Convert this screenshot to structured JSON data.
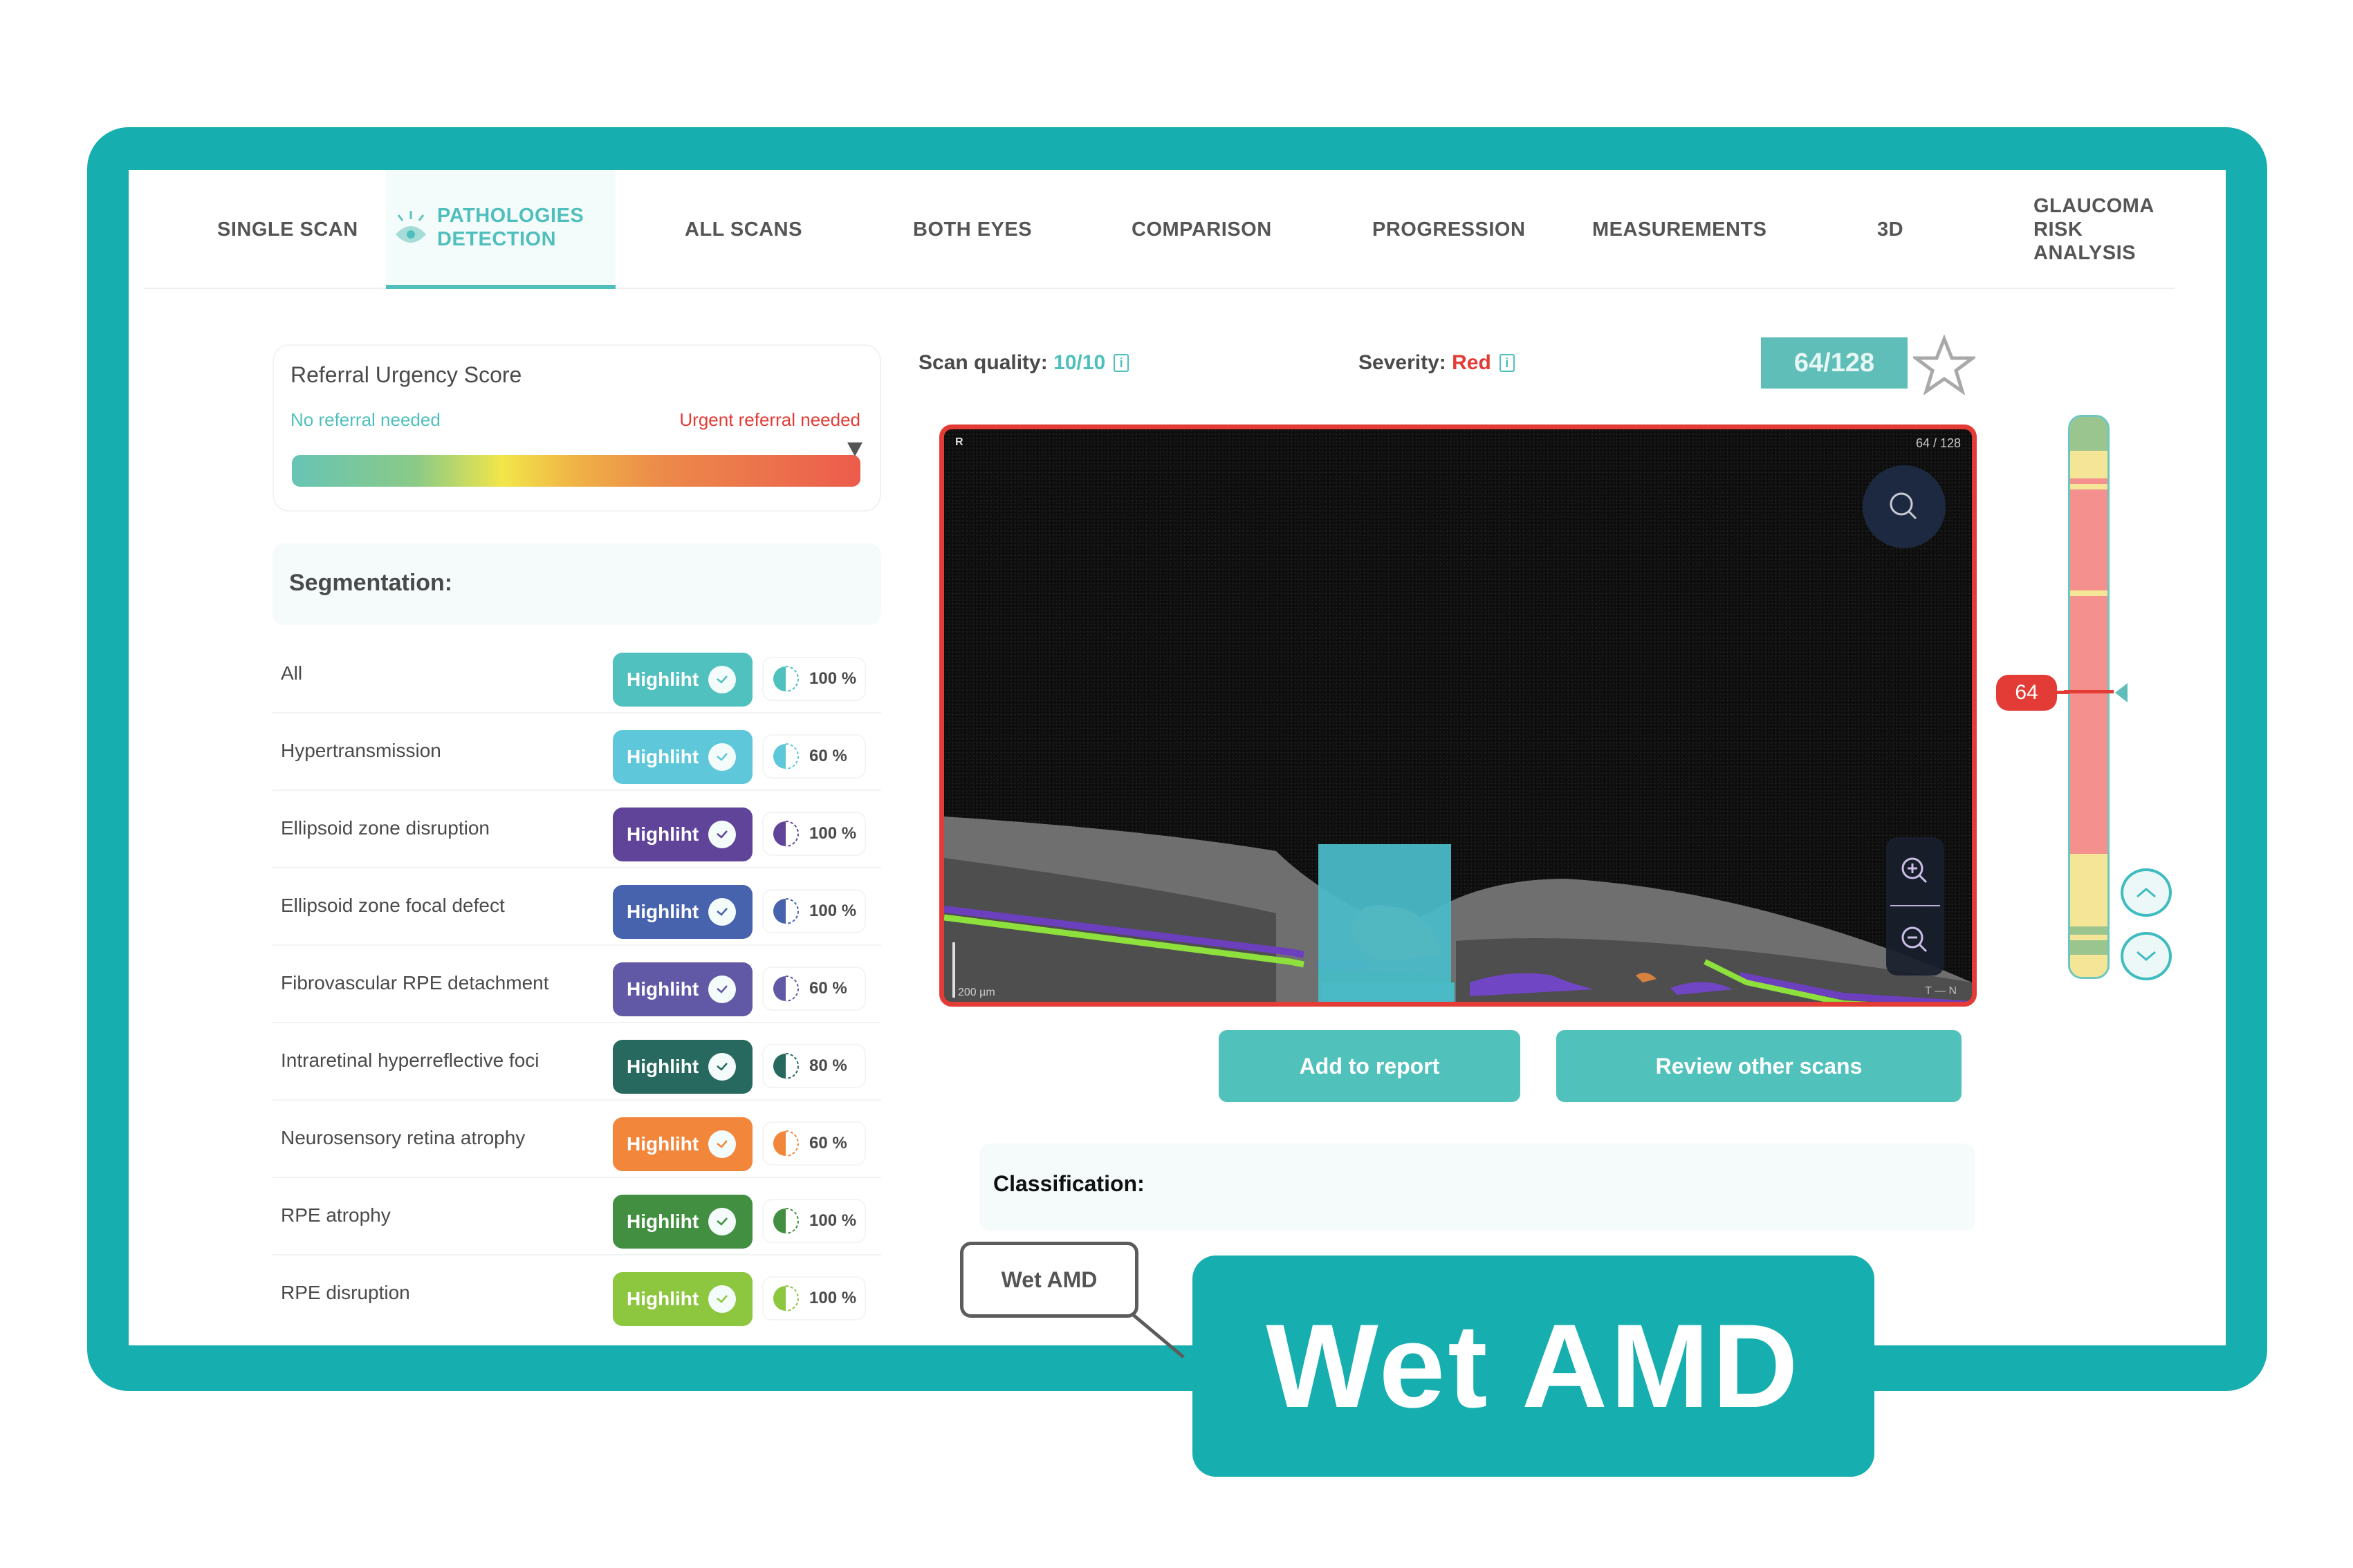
{
  "nav": {
    "tabs": [
      {
        "label": "SINGLE SCAN",
        "active": false
      },
      {
        "label": "PATHOLOGIES DETECTION",
        "active": true,
        "icon": "eye-icon"
      },
      {
        "label": "ALL SCANS",
        "active": false
      },
      {
        "label": "BOTH EYES",
        "active": false
      },
      {
        "label": "COMPARISON",
        "active": false
      },
      {
        "label": "PROGRESSION",
        "active": false
      },
      {
        "label": "MEASUREMENTS",
        "active": false
      },
      {
        "label": "3D",
        "active": false
      },
      {
        "label": "GLAUCOMA RISK ANALYSIS",
        "active": false
      }
    ]
  },
  "urgency": {
    "title": "Referral Urgency Score",
    "low_label": "No referral needed",
    "high_label": "Urgent referral needed",
    "score_fraction": 0.99
  },
  "segmentation": {
    "title": "Segmentation:",
    "button_label": "Highliht",
    "items": [
      {
        "name": "All",
        "color": "#51c1bf",
        "opacity": "100 %"
      },
      {
        "name": "Hypertransmission",
        "color": "#5ec8da",
        "opacity": "60 %"
      },
      {
        "name": "Ellipsoid zone disruption",
        "color": "#5f4499",
        "opacity": "100 %"
      },
      {
        "name": "Ellipsoid zone focal defect",
        "color": "#4763ad",
        "opacity": "100 %"
      },
      {
        "name": "Fibrovascular RPE detachment",
        "color": "#6259a6",
        "opacity": "60 %"
      },
      {
        "name": "Intraretinal hyperreflective foci",
        "color": "#27695f",
        "opacity": "80 %"
      },
      {
        "name": "Neurosensory retina atrophy",
        "color": "#f2873b",
        "opacity": "60 %"
      },
      {
        "name": "RPE atrophy",
        "color": "#438f42",
        "opacity": "100 %"
      },
      {
        "name": "RPE disruption",
        "color": "#8dc63f",
        "opacity": "100 %"
      }
    ]
  },
  "scan_info": {
    "quality_label": "Scan quality:",
    "quality_value": "10/10",
    "severity_label": "Severity:",
    "severity_value": "Red",
    "info_icon": "i",
    "slice_badge": "64/128"
  },
  "scan": {
    "eye": "R",
    "slice_index": "64 / 128",
    "scale": "200 µm",
    "orientation_left": "T",
    "orientation_right": "N"
  },
  "actions": {
    "add_to_report": "Add to report",
    "review_other": "Review other scans"
  },
  "classification": {
    "title": "Classification:",
    "value": "Wet AMD",
    "callout": "Wet AMD"
  },
  "slice_bar": {
    "current": "64",
    "total": 128,
    "current_fraction": 0.5,
    "segments": [
      {
        "from": 0.0,
        "to": 0.06,
        "color": "#9bc58f"
      },
      {
        "from": 0.06,
        "to": 0.11,
        "color": "#f5e597"
      },
      {
        "from": 0.11,
        "to": 0.12,
        "color": "#f4918f"
      },
      {
        "from": 0.12,
        "to": 0.13,
        "color": "#f5e597"
      },
      {
        "from": 0.13,
        "to": 0.31,
        "color": "#f4918f"
      },
      {
        "from": 0.31,
        "to": 0.32,
        "color": "#f5e597"
      },
      {
        "from": 0.32,
        "to": 0.78,
        "color": "#f4918f"
      },
      {
        "from": 0.78,
        "to": 0.91,
        "color": "#f5e597"
      },
      {
        "from": 0.91,
        "to": 0.925,
        "color": "#9bc58f"
      },
      {
        "from": 0.925,
        "to": 0.935,
        "color": "#f5e597"
      },
      {
        "from": 0.935,
        "to": 0.96,
        "color": "#9bc58f"
      },
      {
        "from": 0.96,
        "to": 1.0,
        "color": "#f5e597"
      }
    ]
  }
}
